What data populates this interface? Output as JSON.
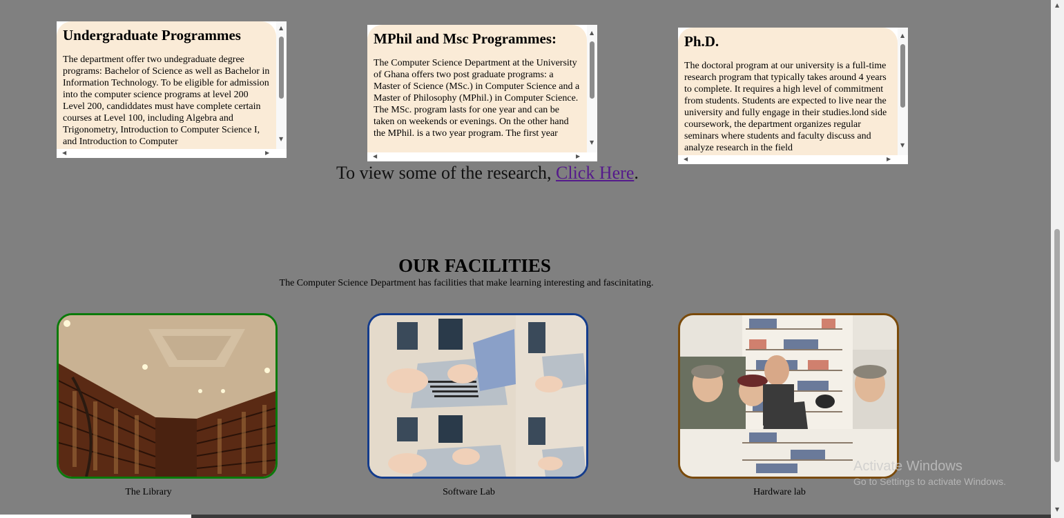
{
  "programmes": [
    {
      "title": "Undergraduate Programmes",
      "body": "The department offer two undegraduate degree programs: Bachelor of Science as well as Bachelor in Information Technology. To be eligible for admission into the computer science programs at level 200 Level 200, candiddates must have complete certain courses at Level 100, including Algebra and Trigonometry, Introduction to Computer Science I, and Introduction to Computer"
    },
    {
      "title": "MPhil and Msc Programmes:",
      "body": "The Computer Science Department at the University of Ghana offers two post graduate programs: a Master of Science (MSc.) in Computer Science and a Master of Philosophy (MPhil.) in Computer Science.\nThe MSc. program lasts for one year and can be taken on weekends or evenings. On the other hand the MPhil. is a two year program. The first year"
    },
    {
      "title": "Ph.D.",
      "body": "The doctoral program at our university is a full-time research program that typically takes around 4 years to complete. It requires a high level of commitment from students. Students are expected to live near the university and fully engage in their studies.lond side coursework, the department organizes regular seminars where students and faculty discuss and analyze research in the field"
    }
  ],
  "research": {
    "prefix": "To view some of the research, ",
    "link_text": "Click Here",
    "suffix": "."
  },
  "facilities": {
    "title": "OUR FACILITIES",
    "subtitle": "The Computer Science Department has facilities that make learning interesting and fascinitating.",
    "items": [
      {
        "caption": "The Library",
        "border_color": "#0a7a0a"
      },
      {
        "caption": "Software Lab",
        "border_color": "#143c8c"
      },
      {
        "caption": "Hardware lab",
        "border_color": "#7a4a0a"
      }
    ]
  },
  "watermark": {
    "line1": "Activate Windows",
    "line2": "Go to Settings to activate Windows."
  },
  "colors": {
    "page_background": "#808080",
    "card_background": "#faebd7",
    "link": "#551a8b"
  }
}
